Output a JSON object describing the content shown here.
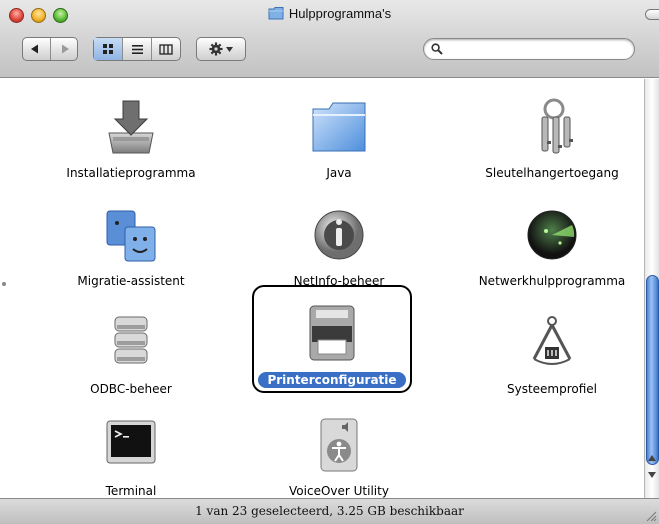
{
  "window": {
    "title": "Hulpprogramma's"
  },
  "toolbar": {
    "back_icon": "back-arrow-icon",
    "forward_icon": "forward-arrow-icon",
    "view_modes": [
      "icon-view",
      "list-view",
      "column-view"
    ],
    "selected_view": "icon-view",
    "action_icon": "gear-icon",
    "search": {
      "value": "",
      "placeholder": ""
    }
  },
  "items": [
    {
      "label": "Installatieprogramma",
      "icon": "installer-icon",
      "selected": false
    },
    {
      "label": "Java",
      "icon": "java-folder-icon",
      "selected": false
    },
    {
      "label": "Sleutelhangertoegang",
      "icon": "keychain-icon",
      "selected": false
    },
    {
      "label": "Migratie-assistent",
      "icon": "migration-assistant-icon",
      "selected": false
    },
    {
      "label": "NetInfo-beheer",
      "icon": "netinfo-icon",
      "selected": false
    },
    {
      "label": "Netwerkhulpprogramma",
      "icon": "network-utility-icon",
      "selected": false
    },
    {
      "label": "ODBC-beheer",
      "icon": "odbc-icon",
      "selected": false
    },
    {
      "label": "Printerconfiguratie",
      "icon": "printer-icon",
      "selected": true
    },
    {
      "label": "Systeemprofiel",
      "icon": "system-profiler-icon",
      "selected": false
    },
    {
      "label": "Terminal",
      "icon": "terminal-icon",
      "selected": false
    },
    {
      "label": "VoiceOver Utility",
      "icon": "voiceover-icon",
      "selected": false
    }
  ],
  "status": {
    "text": "1 van 23 geselecteerd, 3.25 GB beschikbaar"
  },
  "colors": {
    "selection": "#3a6fc6",
    "scroll_thumb": "#5c92e0"
  }
}
